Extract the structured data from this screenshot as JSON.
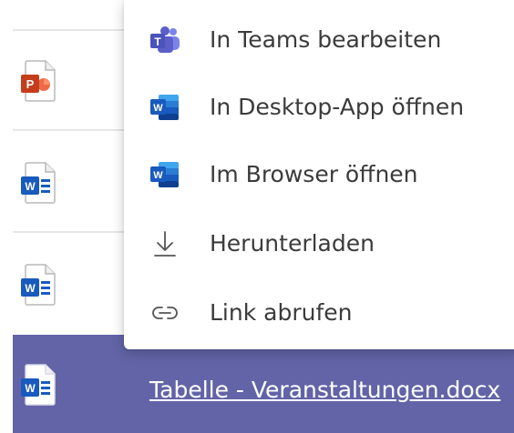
{
  "file_list": {
    "rows": [
      {
        "icon": "powerpoint-file-icon"
      },
      {
        "icon": "word-file-icon"
      },
      {
        "icon": "word-file-icon"
      }
    ],
    "selected_row": {
      "icon": "word-file-icon",
      "name": "Tabelle - Veranstaltungen.docx"
    },
    "colors": {
      "selected_background": "#6264a7",
      "divider": "#e6e6e6"
    }
  },
  "context_menu": {
    "items": [
      {
        "label": "In Teams bearbeiten",
        "icon": "teams-icon"
      },
      {
        "label": "In Desktop-App öffnen",
        "icon": "word-icon"
      },
      {
        "label": "Im Browser öffnen",
        "icon": "word-icon"
      },
      {
        "label": "Herunterladen",
        "icon": "download-icon"
      },
      {
        "label": "Link abrufen",
        "icon": "link-icon"
      }
    ],
    "colors": {
      "text": "#3b3b3b",
      "teams_brand": "#5b5fc7",
      "word_brand": "#185abd"
    }
  }
}
